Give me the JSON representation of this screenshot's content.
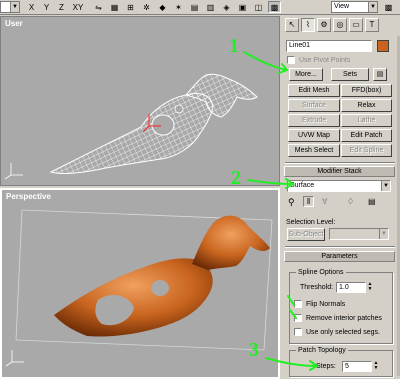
{
  "toolbar": {
    "dropdown_left": "",
    "dropdown_right": "View",
    "axis_buttons": [
      "X",
      "Y",
      "Z",
      "XY"
    ]
  },
  "viewports": {
    "top_label": "User",
    "bottom_label": "Perspective"
  },
  "command_panel": {
    "object_name": "Line01",
    "object_color": "#c8641e",
    "use_pivot_points": "Use Pivot Points",
    "more_button": "More...",
    "sets_button": "Sets",
    "modifier_buttons": [
      [
        "Edit Mesh",
        "FFD(box)"
      ],
      [
        "Surface",
        "Relax"
      ],
      [
        "Extrude",
        "Lathe"
      ],
      [
        "UVW Map",
        "Edit Patch"
      ],
      [
        "Mesh Select",
        "Edit Spline"
      ]
    ],
    "modifier_stack_title": "Modifier Stack",
    "modifier_stack_value": "Surface",
    "selection_level_label": "Selection Level:",
    "sub_object_button": "Sub-Object",
    "parameters_title": "Parameters",
    "spline_options_title": "Spline Options",
    "threshold_label": "Threshold:",
    "threshold_value": "1.0",
    "flip_normals": "Flip Normals",
    "remove_interior": "Remove interior patches",
    "use_only_selected": "Use only selected segs.",
    "patch_topology_title": "Patch Topology",
    "steps_label": "Steps:",
    "steps_value": "5"
  },
  "annotations": [
    "1",
    "2",
    "3"
  ],
  "colors": {
    "annotation": "#22ee22",
    "model_orange": "#c8641e",
    "viewport_bg": "#a9a9a9"
  }
}
